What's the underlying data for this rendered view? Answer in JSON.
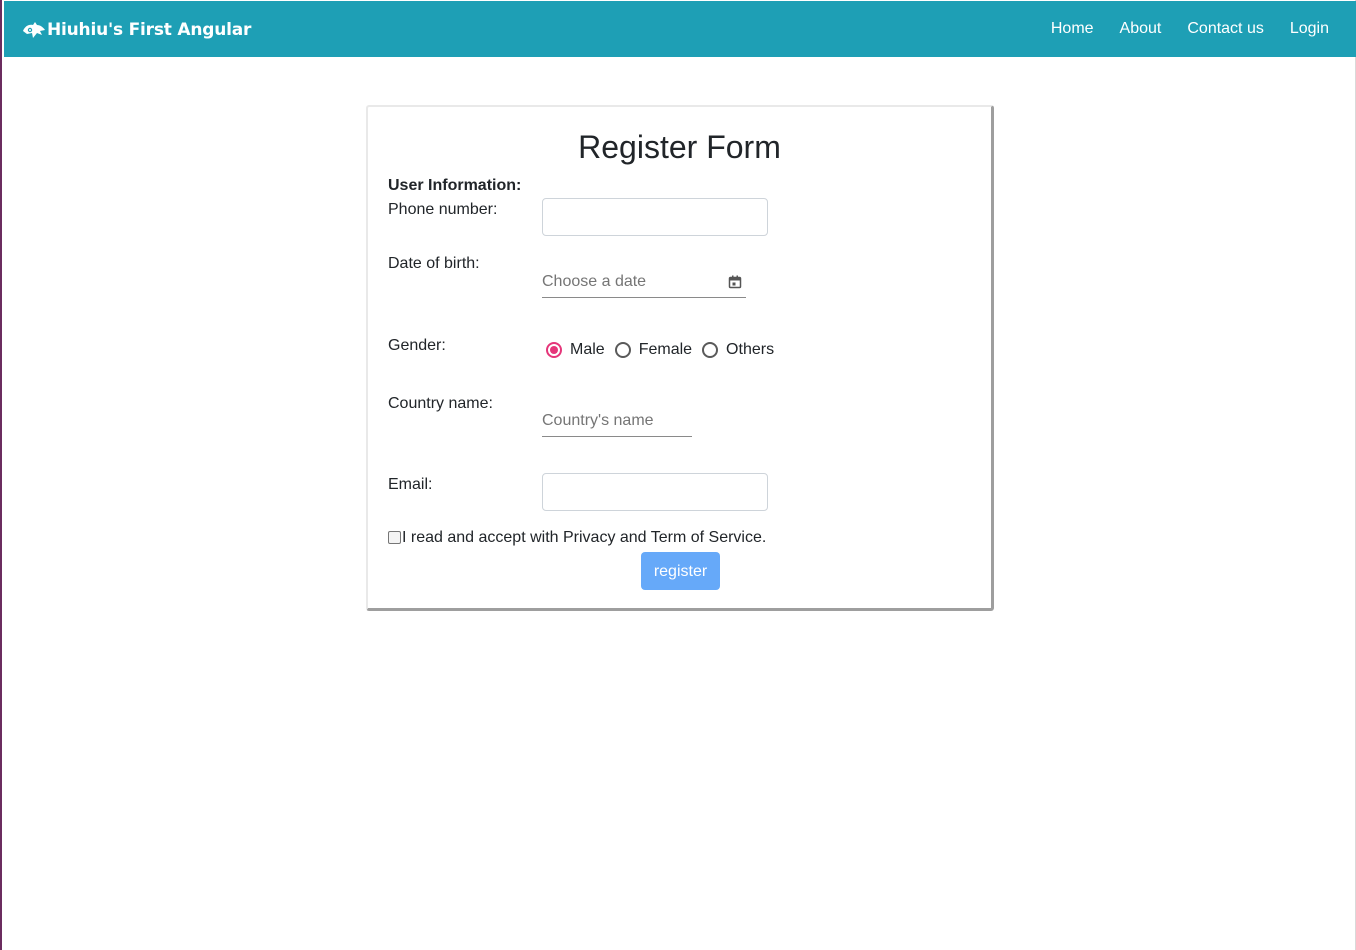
{
  "navbar": {
    "brand": "Hiuhiu's First Angular",
    "brand_icon": "bird-logo-icon",
    "links": [
      "Home",
      "About",
      "Contact us",
      "Login"
    ],
    "background": "#1e9fb5"
  },
  "form": {
    "title": "Register Form",
    "section_label": "User Information:",
    "phone": {
      "label": "Phone number:",
      "value": ""
    },
    "dob": {
      "label": "Date of birth:",
      "placeholder": "Choose a date",
      "icon": "calendar-icon"
    },
    "gender": {
      "label": "Gender:",
      "options": [
        "Male",
        "Female",
        "Others"
      ],
      "selected": "Male",
      "accent": "#e5367a"
    },
    "country": {
      "label": "Country name:",
      "placeholder": "Country's name"
    },
    "email": {
      "label": "Email:",
      "value": ""
    },
    "agree": {
      "label": "I read and accept with Privacy and Term of Service.",
      "checked": false
    },
    "submit_label": "register",
    "submit_color": "#66a9f9"
  }
}
